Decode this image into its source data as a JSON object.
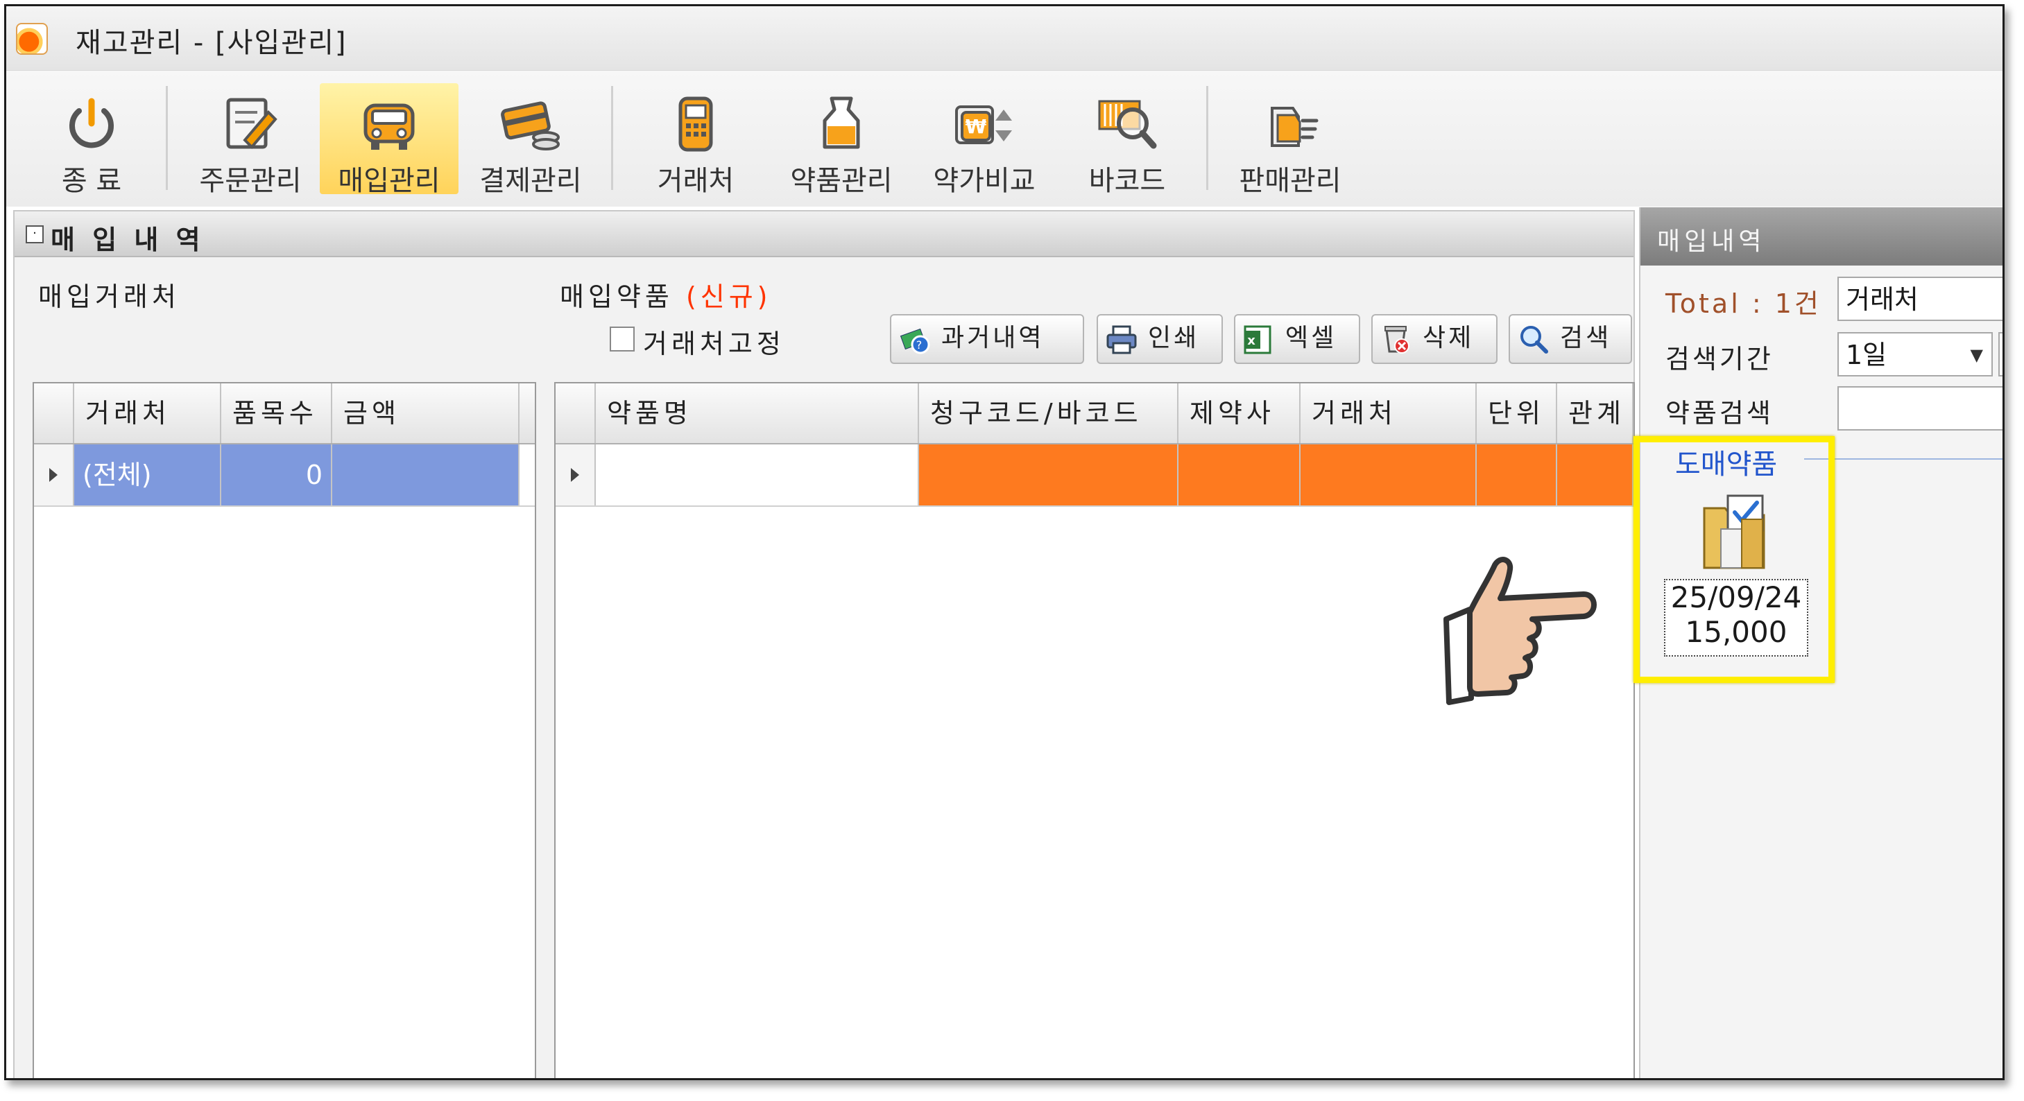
{
  "window": {
    "title": "재고관리 - [사입관리]"
  },
  "toolbar": {
    "items": [
      {
        "label": "종 료",
        "icon": "power-icon"
      },
      {
        "label": "주문관리",
        "icon": "order-document-icon"
      },
      {
        "label": "매입관리",
        "icon": "truck-icon",
        "active": true
      },
      {
        "label": "결제관리",
        "icon": "card-coins-icon"
      },
      {
        "label": "거래처",
        "icon": "calculator-phone-icon"
      },
      {
        "label": "약품관리",
        "icon": "medicine-bottle-icon"
      },
      {
        "label": "약가비교",
        "icon": "won-compare-icon"
      },
      {
        "label": "바코드",
        "icon": "barcode-magnifier-icon"
      },
      {
        "label": "판매관리",
        "icon": "sales-hand-icon"
      }
    ]
  },
  "main": {
    "title": "매 입 내 역",
    "vendor_section_label": "매입거래처",
    "drug_section_label": "매입약품",
    "drug_section_status": "(신규)",
    "fix_vendor_label": "거래처고정",
    "buttons": {
      "history": "과거내역",
      "print": "인쇄",
      "excel": "엑셀",
      "delete": "삭제",
      "search": "검색"
    },
    "vendor_grid": {
      "columns": [
        "거래처",
        "품목수",
        "금액"
      ],
      "rows": [
        {
          "vendor": "(전체)",
          "count": "0",
          "amount": ""
        }
      ]
    },
    "drug_grid": {
      "columns": [
        "약품명",
        "청구코드/바코드",
        "제약사",
        "거래처",
        "단위",
        "관계"
      ],
      "rows": [
        {
          "name": "",
          "code": "",
          "maker": "",
          "vendor": "",
          "unit": "",
          "rel": ""
        }
      ]
    }
  },
  "side": {
    "title": "매입내역",
    "total_label": "Total : 1건",
    "vendor_field": "거래처",
    "period_label": "검색기간",
    "period_value": "1일",
    "drug_search_label": "약품검색",
    "drug_search_value": "",
    "group_title": "도매약품",
    "tile": {
      "date": "25/09/24",
      "amount": "15,000"
    }
  },
  "colors": {
    "selection_blue": "#7e99dd",
    "selection_orange": "#fe7a1f",
    "highlight_yellow": "#ffee00",
    "new_red": "#ff3300",
    "group_blue": "#2255cc"
  }
}
